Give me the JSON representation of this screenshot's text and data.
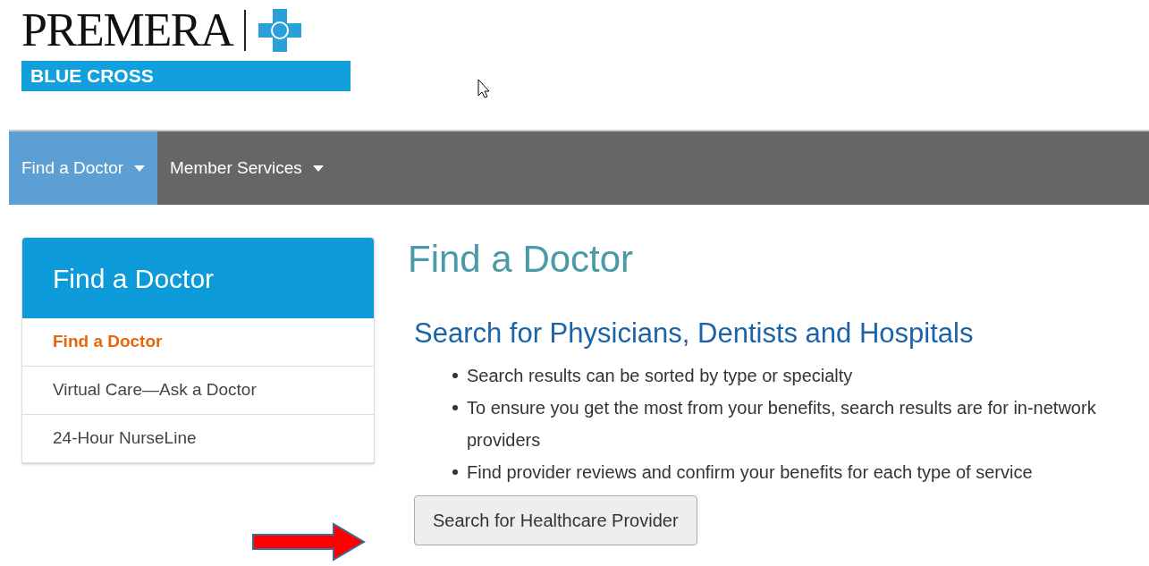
{
  "logo": {
    "wordmark": "PREMERA",
    "tagline": "BLUE CROSS"
  },
  "nav": [
    {
      "label": "Find a Doctor",
      "selected": true
    },
    {
      "label": "Member Services",
      "selected": false
    }
  ],
  "sidebar": {
    "title": "Find a Doctor",
    "items": [
      {
        "label": "Find a Doctor",
        "selected": true
      },
      {
        "label": "Virtual Care—Ask a Doctor",
        "selected": false
      },
      {
        "label": "24-Hour NurseLine",
        "selected": false
      }
    ]
  },
  "main": {
    "title": "Find a Doctor",
    "subtitle": "Search for Physicians, Dentists and Hospitals",
    "bullets": [
      "Search results can be sorted by type or specialty",
      "To ensure you get the most from your benefits, search results are for in-network providers",
      "Find provider reviews and confirm your benefits for each type of service"
    ],
    "button": "Search for Healthcare Provider"
  }
}
